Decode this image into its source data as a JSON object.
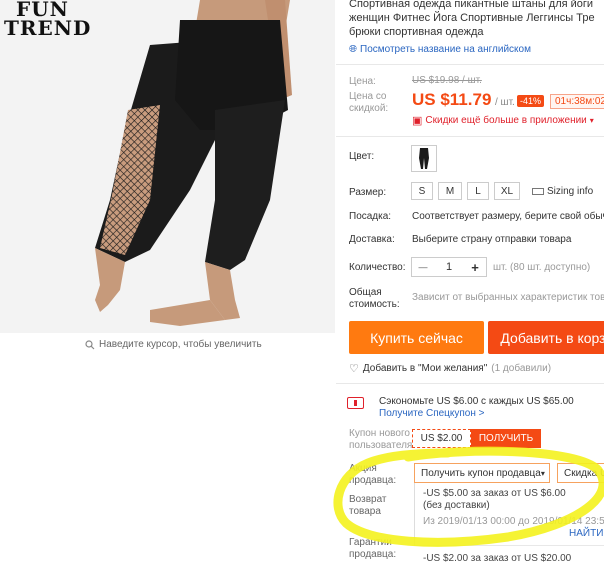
{
  "brand": {
    "logo_line1": "FUN",
    "logo_line2": "TREND"
  },
  "image": {
    "zoom_hint": "Наведите курсор, чтобы увеличить"
  },
  "product": {
    "title_line1": "Спортивная одежда пикантные штаны для йоги",
    "title_line2": "женщин Фитнес Йога Спортивные Леггинсы Тре",
    "title_line3": "брюки спортивная одежда",
    "translate_link": "Посмотреть название на английском"
  },
  "price": {
    "label": "Цена:",
    "old_value": "US $19.98 / шт.",
    "discount_label_line1": "Цена со",
    "discount_label_line2": "скидкой:",
    "new_value": "US $11.79",
    "unit": "/ шт.",
    "discount": "-41%",
    "timer": "01ч:38м:02",
    "app_promo": "Скидки ещё больше в приложении"
  },
  "color": {
    "label": "Цвет:"
  },
  "size": {
    "label": "Размер:",
    "options": [
      "S",
      "M",
      "L",
      "XL"
    ],
    "sizing_info": "Sizing info"
  },
  "fit": {
    "label": "Посадка:",
    "value": "Соответствует размеру, берите свой обычный"
  },
  "shipping": {
    "label": "Доставка:",
    "value": "Выберите страну отправки товара"
  },
  "quantity": {
    "label": "Количество:",
    "minus": "—",
    "value": "1",
    "plus": "+",
    "available": "шт. (80 шт. доступно)"
  },
  "total": {
    "label_line1": "Общая",
    "label_line2": "стоимость:",
    "value": "Зависит от выбранных характеристик товара"
  },
  "actions": {
    "buy_now": "Купить сейчас",
    "add_to_cart": "Добавить в корз"
  },
  "wishlist": {
    "label": "Добавить в \"Мои желания\"",
    "count": "(1 добавили)"
  },
  "coupons": {
    "save_text": "Сэкономьте US $6.00 с каждых US $65.00",
    "get_coupon": "Получите Спецкупон >",
    "new_user_label_line1": "Купон нового",
    "new_user_label_line2": "пользователя",
    "new_user_value": "US $2.00",
    "get_button": "ПОЛУЧИТЬ",
    "seller_promo_label_line1": "Акция",
    "seller_promo_label_line2": "продавца:",
    "seller_coupon_dropdown": "Получить купон продавца",
    "discount_dropdown": "Скидка U",
    "return_label_line1": "Возврат",
    "return_label_line2": "товара",
    "coupon1_line1": "-US $5.00 за заказ от US $6.00",
    "coupon1_line2": "(без доставки)",
    "coupon1_dates": "Из 2019/01/13 00:00 до 2019/01/14 23:59",
    "find_link": "НАЙТИ",
    "guarantee_label_line1": "Гарантии",
    "guarantee_label_line2": "продавца:",
    "coupon2_line1": "-US $2.00 за заказ от US $20.00"
  },
  "colors": {
    "accent_orange": "#ff7a10",
    "accent_red": "#f44a14",
    "link_blue": "#2a66c1",
    "highlight_yellow": "#f4f21e"
  }
}
